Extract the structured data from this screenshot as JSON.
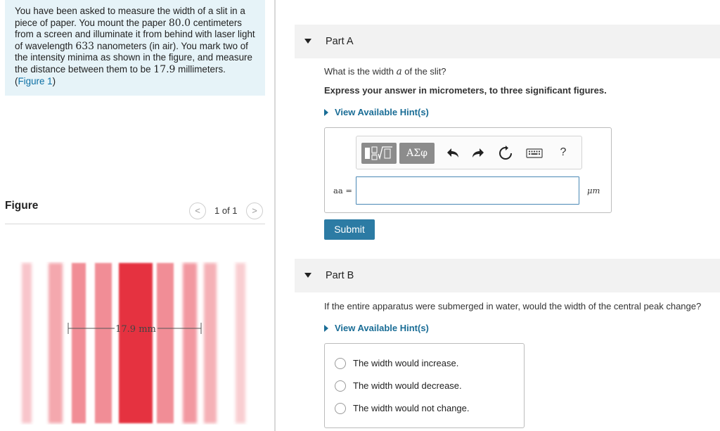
{
  "problem": {
    "text_1": "You have been asked to measure the width of a slit in a piece of paper. You mount the paper ",
    "distance": "80.0",
    "text_2": " centimeters from a screen and illuminate it from behind with laser light of wavelength ",
    "wavelength": "633",
    "text_3": " nanometers (in air). You mark two of the intensity minima as shown in the figure, and measure the distance between them to be ",
    "separation": "17.9",
    "text_4": " millimeters. (",
    "figure_link": "Figure 1",
    "text_5": ")"
  },
  "figure": {
    "title": "Figure",
    "pager": "1 of 1",
    "prev_icon": "chevron-left-icon",
    "next_icon": "chevron-right-icon",
    "measure_label": "17.9 mm",
    "fringe_color": "#e5323f"
  },
  "partA": {
    "label": "Part A",
    "question_pre": "What is the width ",
    "question_var": "a",
    "question_post": " of the slit?",
    "instruction": "Express your answer in micrometers, to three significant figures.",
    "hint": "View Available Hint(s)",
    "toolbar": {
      "greek": "ΑΣφ",
      "help": "?",
      "icons": [
        "template-icon",
        "undo-icon",
        "redo-icon",
        "reset-icon",
        "keyboard-icon",
        "help-icon"
      ]
    },
    "var_label": "aa =",
    "input_value": "",
    "unit": "μm",
    "submit": "Submit"
  },
  "partB": {
    "label": "Part B",
    "question": "If the entire apparatus were submerged in water, would the width of the central peak change?",
    "hint": "View Available Hint(s)",
    "choices": [
      "The width would increase.",
      "The width would decrease.",
      "The width would not change."
    ]
  },
  "colors": {
    "accent": "#2c7ba4",
    "link": "#1a6d96",
    "problem_bg": "#e6f3f8"
  }
}
